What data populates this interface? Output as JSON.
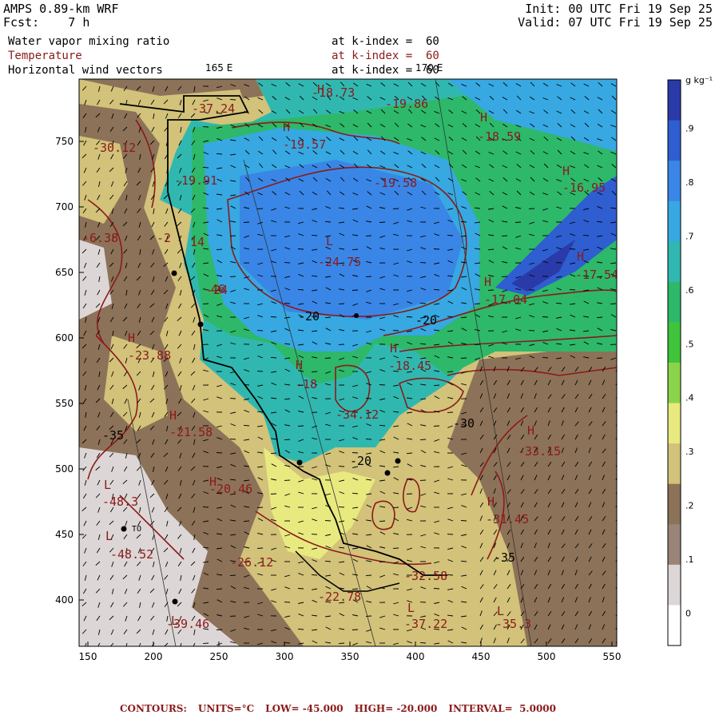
{
  "header": {
    "model": "AMPS 0.89-km WRF",
    "fcst_label": "Fcst:",
    "fcst_value": "7 h",
    "init": "Init: 00 UTC Fri 19 Sep 25",
    "valid": "Valid: 07 UTC Fri 19 Sep 25"
  },
  "fields": [
    {
      "name": "Water vapor mixing ratio",
      "level": "at k-index =  60",
      "color": "#000000"
    },
    {
      "name": "Temperature",
      "level": "at k-index =  60",
      "color": "#8b1a1a"
    },
    {
      "name": "Horizontal wind vectors",
      "level": "at k-index =  60",
      "color": "#000000"
    }
  ],
  "longitude_labels": [
    "165 E",
    "170 E"
  ],
  "x_ticks": [
    "150",
    "200",
    "250",
    "300",
    "350",
    "400",
    "450",
    "500",
    "550"
  ],
  "y_ticks": [
    "750",
    "700",
    "650",
    "600",
    "550",
    "500",
    "450",
    "400"
  ],
  "colorbar": {
    "units": "g kg⁻¹",
    "labels": [
      ".9",
      ".8",
      ".7",
      ".6",
      ".5",
      ".4",
      ".3",
      ".2",
      ".1",
      "0"
    ],
    "colors": [
      "#2a3aa8",
      "#2e5ed0",
      "#3a86e6",
      "#37a8e2",
      "#30b8b0",
      "#2eb86a",
      "#3fc43c",
      "#8ad44a",
      "#e8ea80",
      "#d2c27a",
      "#8c7258",
      "#9a8478",
      "#ddd6d6",
      "#ffffff"
    ]
  },
  "map_labels": [
    {
      "text": "H",
      "kind": "H"
    },
    {
      "text": "-18.73",
      "kind": "v"
    },
    {
      "text": "-19.86",
      "kind": "v"
    },
    {
      "text": "H",
      "kind": "H"
    },
    {
      "text": "-19.57",
      "kind": "v"
    },
    {
      "text": "H",
      "kind": "H"
    },
    {
      "text": "-18.59",
      "kind": "v"
    },
    {
      "text": "-19.58",
      "kind": "v"
    },
    {
      "text": "H",
      "kind": "H"
    },
    {
      "text": "-16.95",
      "kind": "v"
    },
    {
      "text": "-19.91",
      "kind": "v"
    },
    {
      "text": "L",
      "kind": "L"
    },
    {
      "text": "-24.75",
      "kind": "v"
    },
    {
      "text": "H",
      "kind": "H"
    },
    {
      "text": "-17.54",
      "kind": "v"
    },
    {
      "text": "H",
      "kind": "H"
    },
    {
      "text": "-17.04",
      "kind": "v"
    },
    {
      "text": "-20",
      "kind": "c"
    },
    {
      "text": "-20",
      "kind": "c"
    },
    {
      "text": "-46",
      "kind": "v"
    },
    {
      "text": "H",
      "kind": "H"
    },
    {
      "text": "-18.45",
      "kind": "v"
    },
    {
      "text": "H",
      "kind": "H"
    },
    {
      "text": "-18",
      "kind": "v"
    },
    {
      "text": "H",
      "kind": "H"
    },
    {
      "text": "-23.88",
      "kind": "v"
    },
    {
      "text": "-34.12",
      "kind": "v"
    },
    {
      "text": "H",
      "kind": "H"
    },
    {
      "text": "-21.58",
      "kind": "v"
    },
    {
      "text": "-30",
      "kind": "c"
    },
    {
      "text": "H",
      "kind": "H"
    },
    {
      "text": "-33.15",
      "kind": "v"
    },
    {
      "text": "-35",
      "kind": "c"
    },
    {
      "text": "L",
      "kind": "L"
    },
    {
      "text": "-48.3",
      "kind": "v"
    },
    {
      "text": "H",
      "kind": "H"
    },
    {
      "text": "-20.46",
      "kind": "v"
    },
    {
      "text": "H",
      "kind": "H"
    },
    {
      "text": "-31.45",
      "kind": "v"
    },
    {
      "text": "L",
      "kind": "L"
    },
    {
      "text": "-48.52",
      "kind": "v"
    },
    {
      "text": "-26.12",
      "kind": "v"
    },
    {
      "text": "-32.58",
      "kind": "v"
    },
    {
      "text": "-35",
      "kind": "c"
    },
    {
      "text": "-22.78",
      "kind": "v"
    },
    {
      "text": "L",
      "kind": "L"
    },
    {
      "text": "-37.22",
      "kind": "v"
    },
    {
      "text": "L",
      "kind": "L"
    },
    {
      "text": "-35.3",
      "kind": "v"
    },
    {
      "text": "L",
      "kind": "L"
    },
    {
      "text": "-39.46",
      "kind": "v"
    },
    {
      "text": "-20",
      "kind": "c"
    },
    {
      "text": "-6.38",
      "kind": "v"
    },
    {
      "text": "-30.12",
      "kind": "v"
    },
    {
      "text": "-2",
      "kind": "v"
    },
    {
      "text": "14",
      "kind": "v"
    },
    {
      "text": "-37.24",
      "kind": "v"
    },
    {
      "text": "-24",
      "kind": "v"
    },
    {
      "text": "TO",
      "kind": "v"
    }
  ],
  "footer": {
    "contours": "CONTOURS:",
    "units": "UNITS=°C",
    "low": "LOW= -45.000",
    "high": "HIGH= -20.000",
    "interval": "INTERVAL=  5.0000"
  }
}
